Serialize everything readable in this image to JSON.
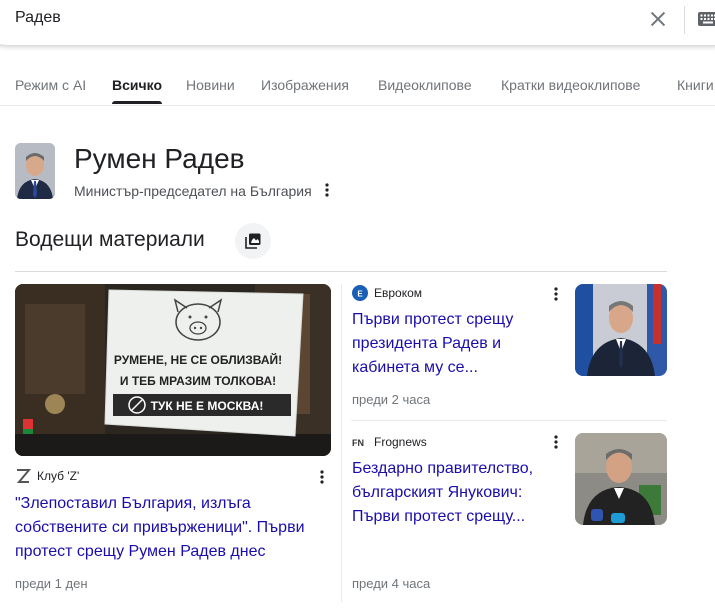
{
  "search": {
    "query": "Радев"
  },
  "tabs": [
    {
      "label": "Режим с AI"
    },
    {
      "label": "Всичко"
    },
    {
      "label": "Новини"
    },
    {
      "label": "Изображения"
    },
    {
      "label": "Видеоклипове"
    },
    {
      "label": "Кратки видеоклипове"
    },
    {
      "label": "Книги"
    }
  ],
  "active_tab": "Всичко",
  "entity": {
    "name": "Румен Радев",
    "description": "Министър-председател на България"
  },
  "top_stories": {
    "title": "Водещи материали",
    "items": [
      {
        "source": "Клуб 'Z'",
        "headline": "\"Злепоставил България, излъга собствените си привърженици\". Първи протест срещу Румен Радев днес",
        "time": "преди 1 ден",
        "image_text": {
          "line1": "РУМЕНЕ, НЕ СЕ ОБЛИЗВАЙ!",
          "line2": "И ТЕБ МРАЗИМ ТОЛКОВА!",
          "line3": "ТУК НЕ Е МОСКВА!"
        }
      },
      {
        "source": "Евроком",
        "headline": "Първи протест срещу президента Радев и кабинета му се...",
        "time": "преди 2 часа"
      },
      {
        "source": "Frognews",
        "headline": "Бездарно правителство, българският Янукович: Първи протест срещу...",
        "time": "преди 4 часа"
      }
    ]
  },
  "colors": {
    "link": "#1a0dab",
    "secondary_text": "#70757a",
    "divider": "#dadce0"
  },
  "icons": [
    "close-icon",
    "keyboard-icon",
    "more-vert-icon",
    "stories-stack-icon"
  ]
}
